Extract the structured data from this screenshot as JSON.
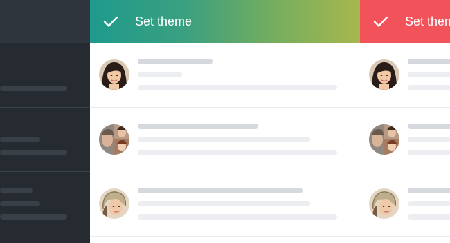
{
  "sidebar": {
    "rows": 3
  },
  "themes": [
    {
      "id": "theme-gradient",
      "action_label": "Set theme",
      "accent_start": "#1f9a8d",
      "accent_end": "#a7b74e"
    },
    {
      "id": "theme-red",
      "action_label": "Set theme",
      "accent": "#f2525a"
    }
  ],
  "icons": {
    "action": "check-icon",
    "avatar": "user-avatar"
  },
  "colors": {
    "sidebar_bg": "#262b31",
    "skeleton_dark": "#d5d8dd",
    "skeleton_light": "#eceef1"
  }
}
